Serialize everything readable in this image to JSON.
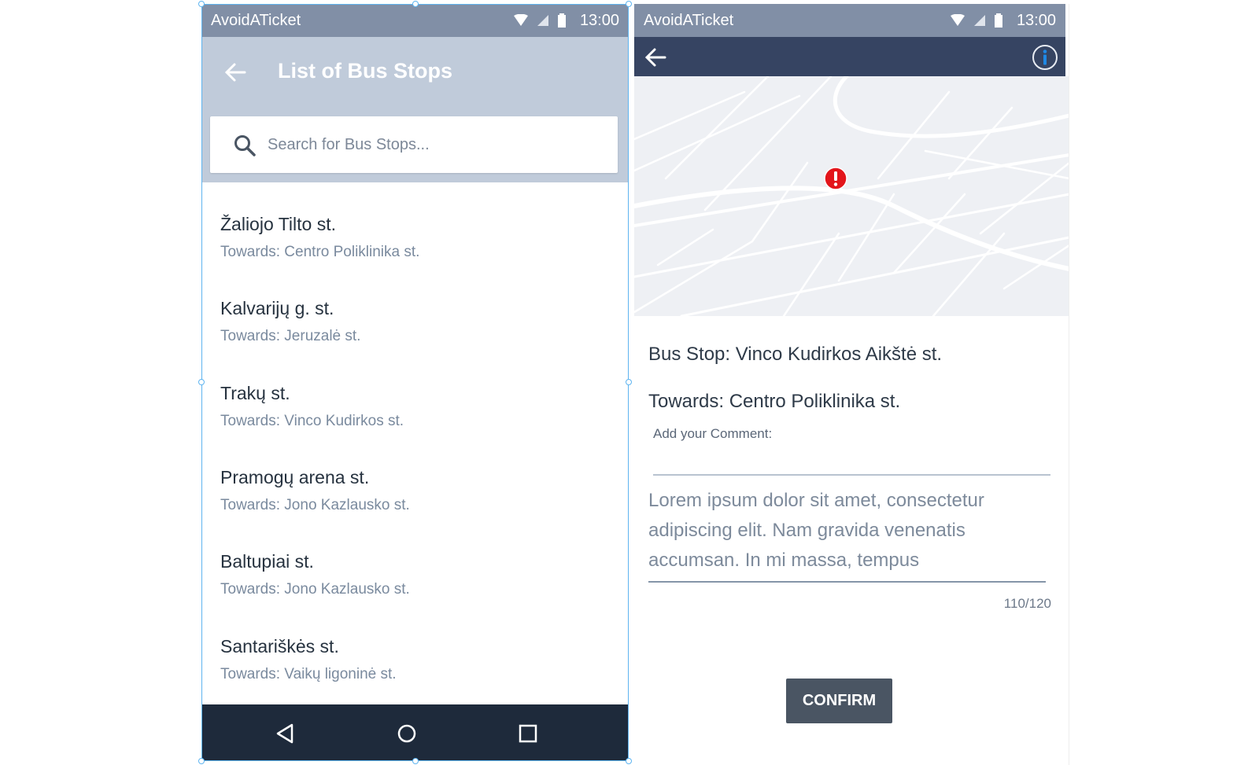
{
  "colors": {
    "status_bar": "#818fa6",
    "list_header": "#c0cbda",
    "detail_header": "#364462",
    "nav_bar": "#1e2a3b",
    "confirm_button": "#4a5563",
    "alert_marker": "#e3151b",
    "info_icon": "#1e88e5"
  },
  "list_screen": {
    "status": {
      "app_name": "AvoidATicket",
      "time": "13:00"
    },
    "title": "List of Bus Stops",
    "search": {
      "placeholder": "Search for Bus Stops...",
      "value": ""
    },
    "stops": [
      {
        "name": "Žaliojo Tilto st.",
        "towards": "Towards: Centro Poliklinika st."
      },
      {
        "name": "Kalvarijų g. st.",
        "towards": "Towards: Jeruzalė st."
      },
      {
        "name": "Trakų st.",
        "towards": "Towards: Vinco Kudirkos st."
      },
      {
        "name": "Pramogų arena st.",
        "towards": "Towards: Jono Kazlausko st."
      },
      {
        "name": "Baltupiai st.",
        "towards": "Towards: Jono Kazlausko st."
      },
      {
        "name": "Santariškės st.",
        "towards": "Towards: Vaikų ligoninė st."
      }
    ],
    "nav_icons": [
      "back-triangle-icon",
      "home-circle-icon",
      "recents-square-icon"
    ]
  },
  "detail_screen": {
    "status": {
      "app_name": "AvoidATicket",
      "time": "13:00"
    },
    "bus_stop": "Bus Stop: Vinco Kudirkos Aikštė st.",
    "towards": "Towards: Centro Poliklinika st.",
    "comment_label": "Add your Comment:",
    "comment_text": "Lorem ipsum dolor sit amet, consectetur adipiscing elit. Nam gravida venenatis accumsan. In mi massa, tempus",
    "char_counter": "110/120",
    "confirm_label": "CONFIRM"
  }
}
